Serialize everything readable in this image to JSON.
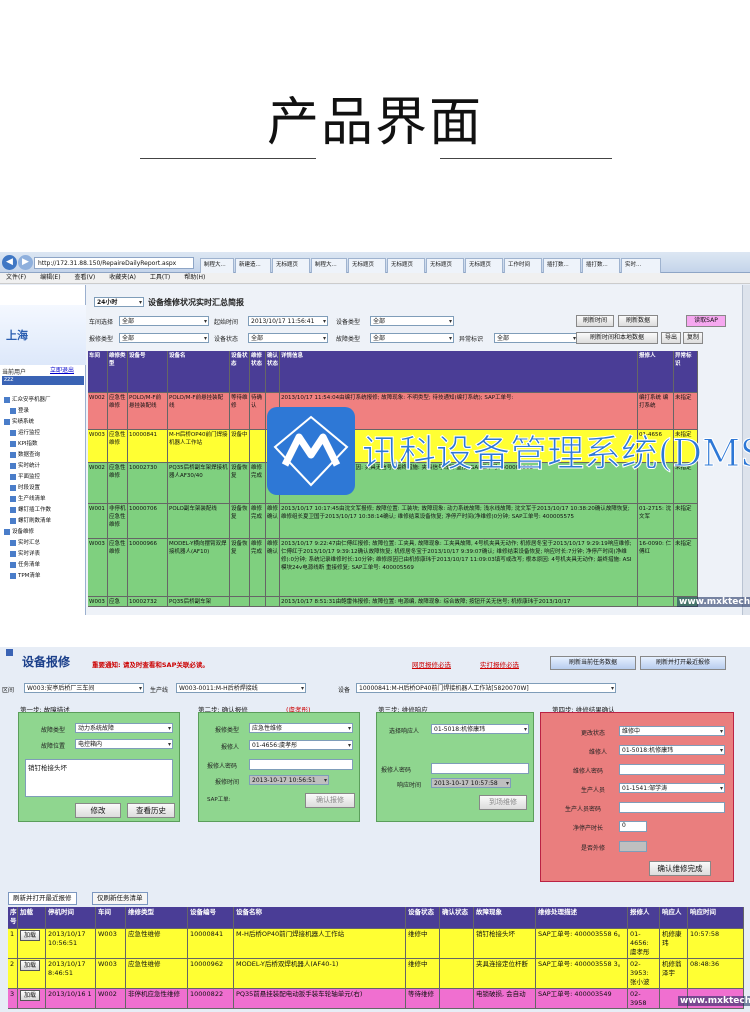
{
  "hero": {
    "title": "产品界面"
  },
  "browser": {
    "address": "http://172.31.88.150/RepaireDailyReport.aspx",
    "tabs": [
      "制程大...",
      "新建造...",
      "无标题页",
      "制程大...",
      "无标题页",
      "无标题页",
      "无标题页",
      "无标题页",
      "工作时间",
      "插打数...",
      "插打数...",
      "实时..."
    ],
    "menu": [
      "文件(F)",
      "编辑(E)",
      "查看(V)",
      "收藏夹(A)",
      "工具(T)",
      "帮助(H)"
    ]
  },
  "sidebar": {
    "logo_text": "上海",
    "user_label": "当前用户",
    "logout": "立即退出",
    "user_value": "zzz",
    "items": [
      "汇众安亭机器厂",
      "登录",
      "实绩系统",
      "运行监控",
      "KPI指数",
      "数据查询",
      "实时统计",
      "平面监控",
      "时段设置",
      "生产线清单",
      "螺钉插工作数",
      "螺钉刷数清单",
      "设备维修",
      "实时汇总",
      "实时详表",
      "任务清单",
      "TPM清单"
    ]
  },
  "report": {
    "range": "24小时",
    "title": "设备维修状况实时汇总简报",
    "filters": {
      "workshop_label": "车间选择",
      "workshop": "全部",
      "start_label": "起始时间",
      "start": "2013/10/17 11:56:41",
      "devtype_label": "设备类型",
      "devtype": "全部",
      "repairtype_label": "报修类型",
      "repairtype": "全部",
      "devstate_label": "设备状态",
      "devstate": "全部",
      "faulttype_label": "故障类型",
      "faulttype": "全部",
      "abnormal_label": "异常标识",
      "abnormal": "全部"
    },
    "buttons": [
      "刷新时间",
      "刷新数据",
      "读取SAP",
      "刷新时间和本地数据",
      "导出",
      "复制"
    ],
    "headers": [
      "车间",
      "维修类型",
      "设备号",
      "设备名",
      "设备状态",
      "维修状态",
      "确认状态",
      "详情信息",
      "报修人",
      "异常标识"
    ],
    "rows": [
      {
        "bg": "#f08080",
        "cells": [
          "W002",
          "应急性维修",
          "POLO/M-F前悬挂装配线",
          "POLO/M-F前悬挂装配线",
          "等待维修",
          "待确认",
          "",
          "2013/10/17 11:54:04由编打系统报修; 故障现象: 不明类型; 待技通知(编打系统); SAP工单号:",
          "编打系统 编打系统",
          "未指定"
        ]
      },
      {
        "bg": "#ffff33",
        "cells": [
          "W003",
          "应急性维修",
          "10000841",
          "M-H后桥OP40前门焊接机器人工作站",
          "设备中",
          "",
          "",
          "维修中",
          "01-4656",
          "未指定"
        ]
      },
      {
        "bg": "#7fd07f",
        "cells": [
          "W002",
          "应急性维修",
          "10002730",
          "PQ35后桥副车架焊接机器人AF30/40",
          "设备恢复",
          "维修完成",
          "维修确认",
          "2013/10/17 10:55:... 根本原因: 夹具无信号; 最终措施: 夹具信号线断 重接; SAP工单号: 400003582",
          "",
          "未指定"
        ]
      },
      {
        "bg": "#7fd07f",
        "cells": [
          "W001",
          "非停机应急性维修",
          "10000706",
          "POLO副车架装配线",
          "设备恢复",
          "维修完成",
          "维修确认",
          "2013/10/17 10:17:45由沈文军报修; 故障位置: 工装块; 故障现象: 动力系统故障; 浅水线故障; 沈文军于2013/10/17 10:38:20确认故障恢复; 维修组长夏卫国于2013/10/17 10:38:14确认; 维修结束设备恢复; 净停产时间(净维修)0分钟; SAP工单号: 400005575",
          "01-2715: 沈文军",
          "未指定"
        ]
      },
      {
        "bg": "#7fd07f",
        "cells": [
          "W003",
          "应急性维修",
          "10000966",
          "MODEL-Y横向摆臂双焊接机器人(AF10)",
          "设备恢复",
          "维修完成",
          "维修确认",
          "2013/10/17 9:22:47由仁傅红报修; 故障位置: 工夹具, 故障现象: 工夹具故障, 4号机夹具无动作; 机修居冬宝于2013/10/17 9:29:19响应维修; 仁傅红于2013/10/17 9:39:12确认故障恢复; 机修居冬宝于2013/10/17 9:39:07确认; 维修结束设备恢复; 响应时长:7分钟; 净停产时间(净维修):0分钟; 系统记录维修时长:10分钟; 维修原因已由机修康玮于2013/10/17 11:09:03填写或改写; 根本原因: 4号机夹具无动作; 最终措施: ASI模块24v电源线断 重接修复; SAP工单号: 400005569",
          "16-0090: 仁傅红",
          "未指定"
        ]
      },
      {
        "bg": "#7fd07f",
        "cells": [
          "W003",
          "应急",
          "10002732",
          "PQ35后桥副车架",
          "",
          "",
          "",
          "2013/10/17 8:51:31由鲍雷伟报修; 故障位置: 电源编, 故障现象: 综合故障; 按钮开关无信号; 机修康玮于2013/10/17",
          "",
          ""
        ]
      }
    ]
  },
  "watermark": {
    "text": "讯科设备管理系统(DMS)"
  },
  "site": "www.mxktech.com",
  "repair": {
    "title": "设备报修",
    "notice": "重要通知: 请及时查看和SAP关联必读。",
    "links": [
      "网页报修必选",
      "实打报修必选"
    ],
    "top_buttons": [
      "刷新当前任务数据",
      "刷新并打开最近报修"
    ],
    "area_label": "区间",
    "area": "W003:安亭后桥厂三车间",
    "line_label": "生产线",
    "line": "W003-0011:M-H后桥焊接线",
    "device_label": "设备",
    "device": "10000841:M-H后桥OP40前门焊接机器人工作站[5820070W]",
    "step1": {
      "head": "第一步: 故障描述",
      "type_label": "故障类型",
      "type": "动力系统故障",
      "pos_label": "故障位置",
      "pos": "电控箱内",
      "desc": "销钉枪接头坏",
      "btn_edit": "修改",
      "btn_history": "查看历史"
    },
    "step2": {
      "head": "第二步: 确认报修",
      "note": "(虞孝彤)",
      "repair_type_label": "报修类型",
      "repair_type": "应急性维修",
      "reporter_label": "报修人",
      "reporter": "01-4656:虞孝彤",
      "pwd_label": "报修人密码",
      "time_label": "报修时间",
      "time": "2013-10-17 10:56:51",
      "sap_label": "SAP工单:",
      "btn": "确认报修"
    },
    "step3": {
      "head": "第三步: 维修响应",
      "responder_label": "选择响应人",
      "responder": "01-5018:机修康玮",
      "pwd_label": "报修人密码",
      "time_label": "响应时间",
      "time": "2013-10-17 10:57:58",
      "btn": "到场维修"
    },
    "step4": {
      "head": "第四步: 维修结果确认",
      "state_label": "更改状态",
      "state": "维修中",
      "repairer_label": "维修人",
      "repairer": "01-5018:机修康玮",
      "pwd_label": "维修人密码",
      "prod_label": "生产人员",
      "prod": "01-1541:邹学涛",
      "prod_pwd_label": "生产人员密码",
      "downtime_label": "净停产时长",
      "downtime": "0",
      "outsource_label": "是否外修",
      "btn": "确认维修完成"
    },
    "tabs": [
      "刷新并打开最近报修",
      "仅刷新任务清单"
    ],
    "headers": [
      "序号",
      "加载",
      "停机时间",
      "车间",
      "维修类型",
      "设备编号",
      "设备名称",
      "设备状态",
      "确认状态",
      "故障现象",
      "维修处理描述",
      "报修人",
      "响应人",
      "响应时间"
    ],
    "load_label": "加载",
    "rows": [
      {
        "bg": "#ffff33",
        "cells": [
          "1",
          "",
          "2013/10/17 10:56:51",
          "W003",
          "应急性维修",
          "10000841",
          "M-H后桥OP40前门焊接机器人工作站",
          "维修中",
          "",
          "销钉枪接头坏",
          "SAP工单号: 400003558 6。",
          "01-4656: 虞孝彤",
          "机修康玮",
          "10:57:58"
        ]
      },
      {
        "bg": "#ffff33",
        "cells": [
          "2",
          "",
          "2013/10/17 8:46:51",
          "W003",
          "应急性维修",
          "10000962",
          "MODEL-Y后桥双焊机器人(AF40-1)",
          "维修中",
          "",
          "夹具连接定位杆断",
          "SAP工单号: 400003558 3。",
          "02-3953: 张小波",
          "机修翁泽宇",
          "08:48:36"
        ]
      },
      {
        "bg": "#f06fd0",
        "cells": [
          "3",
          "",
          "2013/10/16 1",
          "W002",
          "非停机应急性维修",
          "10000822",
          "PQ35前悬挂装配电动扳手装车轮轴单元(右)",
          "等待维修",
          "",
          "电锁破损, 会自动",
          "SAP工单号: 400003549",
          "02-3958",
          "",
          ""
        ]
      }
    ]
  }
}
